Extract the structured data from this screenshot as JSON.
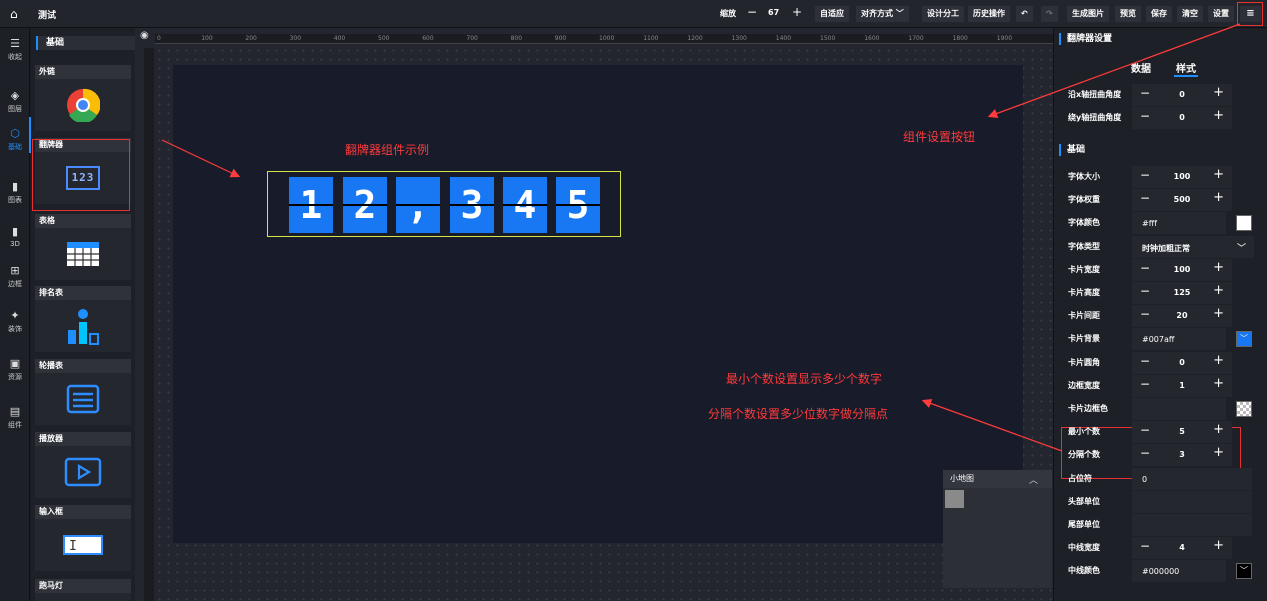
{
  "topbar": {
    "title": "测试",
    "zoom_label": "缩放",
    "zoom_value": "67",
    "buttons": [
      "自适应",
      "对齐方式 ﹀",
      "设计分工",
      "历史操作",
      "↶",
      "↷",
      "生成图片",
      "预览",
      "保存",
      "清空",
      "设置",
      "≡"
    ]
  },
  "nav": [
    {
      "icon": "☰",
      "label": "收起"
    },
    {
      "icon": "◈",
      "label": "图层"
    },
    {
      "icon": "⬡",
      "label": "基础"
    },
    {
      "icon": "▮",
      "label": "图表"
    },
    {
      "icon": "▮",
      "label": "3D"
    },
    {
      "icon": "⊞",
      "label": "边框"
    },
    {
      "icon": "✦",
      "label": "装饰"
    },
    {
      "icon": "▣",
      "label": "资源"
    },
    {
      "icon": "▤",
      "label": "组件"
    }
  ],
  "components": {
    "header": "基础",
    "items": [
      "外链",
      "翻牌器",
      "表格",
      "排名表",
      "轮播表",
      "播放器",
      "输入框",
      "跑马灯"
    ],
    "flip_icon_text": "123"
  },
  "ruler": [
    "0",
    "100",
    "200",
    "300",
    "400",
    "500",
    "600",
    "700",
    "800",
    "900",
    "1000",
    "1100",
    "1200",
    "1300",
    "1400",
    "1500",
    "1600",
    "1700",
    "1800",
    "1900"
  ],
  "flip_digits": [
    "1",
    "2",
    ",",
    "3",
    "4",
    "5"
  ],
  "annotations": {
    "example": "翻牌器组件示例",
    "settings_btn": "组件设置按钮",
    "min_count": "最小个数设置显示多少个数字",
    "sep_count": "分隔个数设置多少位数字做分隔点"
  },
  "minimap": {
    "title": "小地图"
  },
  "panel": {
    "title": "翻牌器设置",
    "tabs": [
      "数据",
      "样式"
    ],
    "section": "基础",
    "top_rows": [
      {
        "label": "沿x轴扭曲角度",
        "value": "0"
      },
      {
        "label": "绕y轴扭曲角度",
        "value": "0"
      }
    ],
    "rows": [
      {
        "label": "字体大小",
        "type": "stepper",
        "value": "100"
      },
      {
        "label": "字体权重",
        "type": "stepper",
        "value": "500"
      },
      {
        "label": "字体颜色",
        "type": "color",
        "value": "#fff",
        "swatch": "#ffffff"
      },
      {
        "label": "字体类型",
        "type": "select",
        "value": "时钟加粗正常"
      },
      {
        "label": "卡片宽度",
        "type": "stepper",
        "value": "100"
      },
      {
        "label": "卡片高度",
        "type": "stepper",
        "value": "125"
      },
      {
        "label": "卡片间距",
        "type": "stepper",
        "value": "20"
      },
      {
        "label": "卡片背景",
        "type": "color",
        "value": "#007aff",
        "swatch": "#1877f2"
      },
      {
        "label": "卡片圆角",
        "type": "stepper",
        "value": "0"
      },
      {
        "label": "边框宽度",
        "type": "stepper",
        "value": "1"
      },
      {
        "label": "卡片边框色",
        "type": "color",
        "value": "",
        "swatch": "transparent"
      },
      {
        "label": "最小个数",
        "type": "stepper",
        "value": "5"
      },
      {
        "label": "分隔个数",
        "type": "stepper",
        "value": "3"
      },
      {
        "label": "占位符",
        "type": "text",
        "value": "0"
      },
      {
        "label": "头部单位",
        "type": "text",
        "value": ""
      },
      {
        "label": "尾部单位",
        "type": "text",
        "value": ""
      },
      {
        "label": "中线宽度",
        "type": "stepper",
        "value": "4"
      },
      {
        "label": "中线颜色",
        "type": "color",
        "value": "#000000",
        "swatch": "#000000"
      }
    ]
  },
  "colors": {
    "accent": "#1f8fff",
    "card": "#1877f2",
    "annotation": "#ff3b3b"
  }
}
